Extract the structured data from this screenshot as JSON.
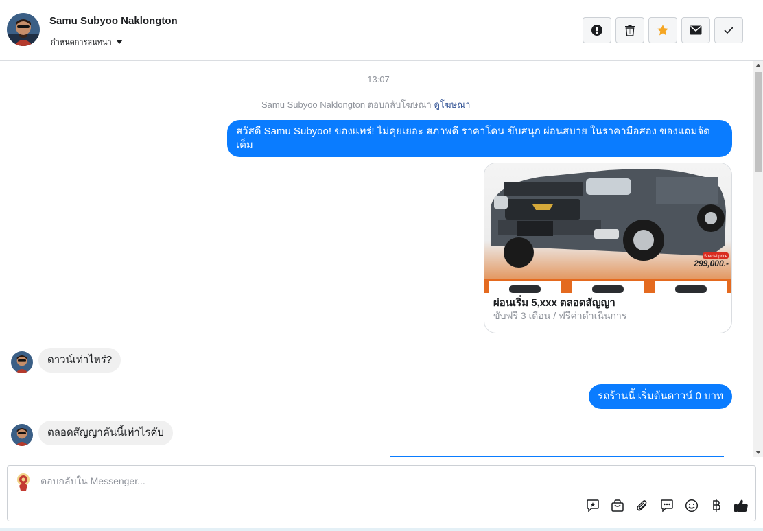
{
  "header": {
    "name": "Samu Subyoo Naklongton",
    "assign_label": "กำหนดการสนทนา",
    "actions": [
      "mark-spam",
      "delete",
      "star",
      "mark-unread",
      "done"
    ]
  },
  "conversation": {
    "time": "13:07",
    "reply_note_prefix": "Samu Subyoo Naklongton ตอบกลับโฆษณา",
    "reply_note_link": "ดูโฆษณา",
    "messages": [
      {
        "from": "page",
        "text": "สวัสดี Samu Subyoo! ของแทร่! ไม่คุยเยอะ สภาพดี ราคาโดน ขับสนุก ผ่อนสบาย ในราคามือสอง ของแถมจัดเต็ม"
      },
      {
        "from": "user",
        "text": "ดาวน์เท่าไหร่?"
      },
      {
        "from": "page",
        "text": "รถร้านนี้ เริ่มต้นดาวน์ 0 บาท"
      },
      {
        "from": "user",
        "text": "ตลอดสัญญาคันนี้เท่าไรคับ"
      }
    ],
    "card": {
      "title": "ผ่อนเริ่ม 5,xxx ตลอดสัญญา",
      "subtitle": "ขับฟรี 3 เดือน / ฟรีค่าดำเนินการ",
      "price_tag": "299,000.-",
      "special_tag": "Special price"
    }
  },
  "composer": {
    "placeholder": "ตอบกลับใน Messenger...",
    "tools": [
      "saved-reply-icon",
      "shop-bag-icon",
      "attach-icon",
      "quick-reply-icon",
      "emoji-icon",
      "baht-icon",
      "like-icon"
    ]
  },
  "colors": {
    "accent": "#0a7cff",
    "star": "#f5a623",
    "incoming_bg": "#f0f0f0"
  }
}
